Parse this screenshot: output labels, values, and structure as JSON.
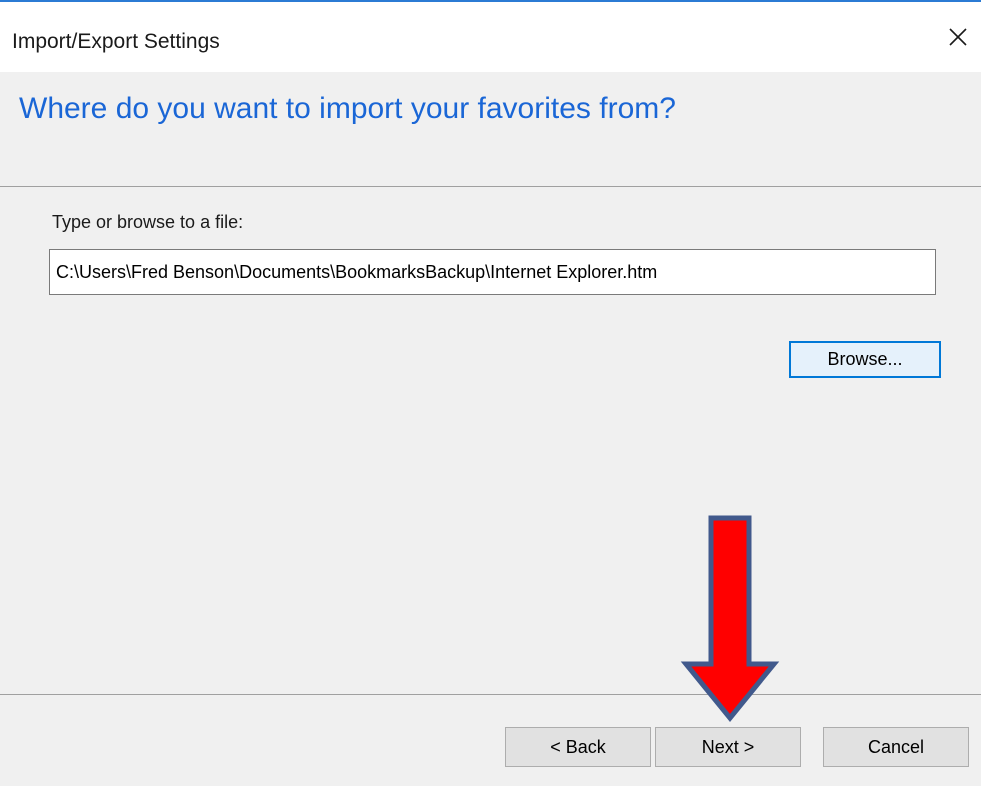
{
  "window": {
    "title": "Import/Export Settings",
    "accent_color": "#2b7bd4"
  },
  "close_icon": "close-icon",
  "wizard": {
    "heading": "Where do you want to import your favorites from?",
    "heading_color": "#1a66d6",
    "file_label": "Type or browse to a file:",
    "file_path": "C:\\Users\\Fred Benson\\Documents\\BookmarksBackup\\Internet Explorer.htm",
    "browse_label": "Browse..."
  },
  "footer": {
    "back_label": "< Back",
    "next_label": "Next >",
    "cancel_label": "Cancel"
  },
  "annotation": {
    "icon": "down-arrow-icon",
    "fill_color": "#ff0000",
    "stroke_color": "#41598c"
  }
}
